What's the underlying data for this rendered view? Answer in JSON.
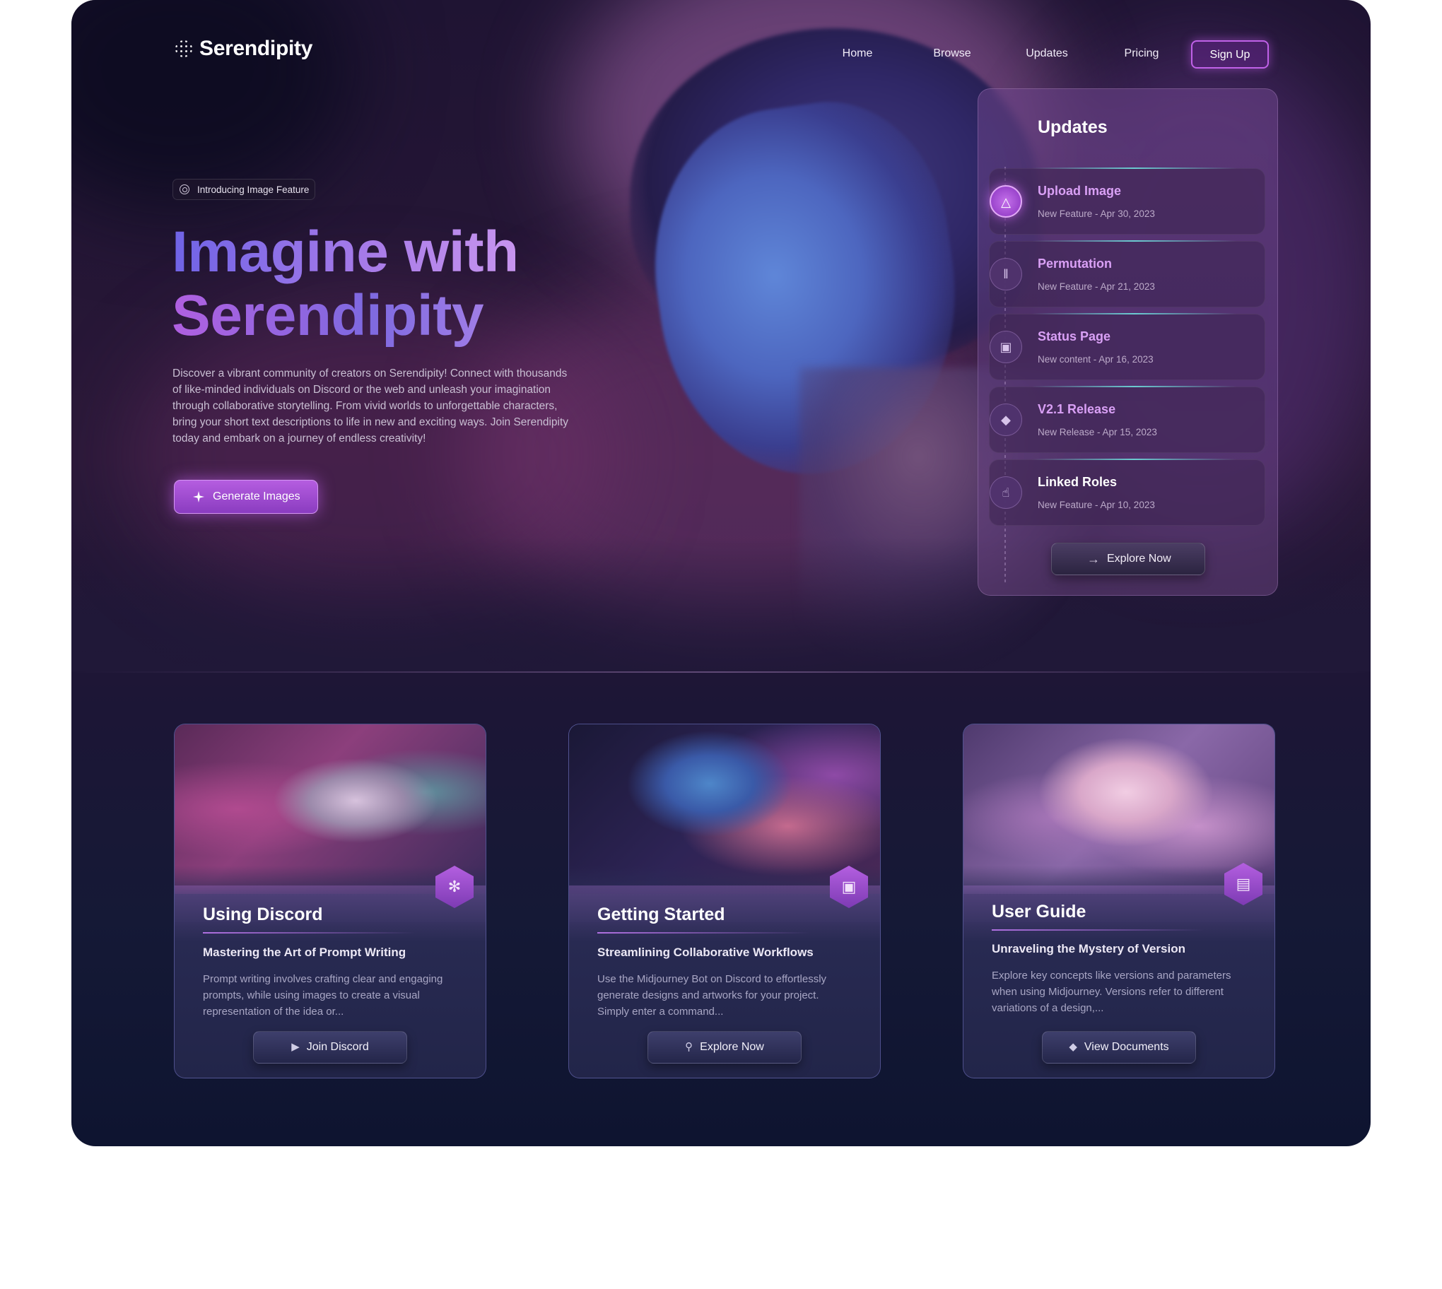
{
  "brand": {
    "name": "Serendipity"
  },
  "nav": {
    "items": [
      "Home",
      "Browse",
      "Updates",
      "Pricing"
    ],
    "signup_label": "Sign Up"
  },
  "hero": {
    "badge": "Introducing Image Feature",
    "headline_line1": "Imagine with",
    "headline_line2": "Serendipity",
    "description": "Discover a vibrant community of creators on Serendipity! Connect with thousands of like-minded individuals on Discord or the web and unleash your imagination through collaborative storytelling. From vivid worlds to unforgettable characters, bring your short text descriptions to life in new and exciting ways. Join Serendipity today and embark on a journey of endless creativity!",
    "cta_label": "Generate Images"
  },
  "updates": {
    "title": "Updates",
    "items": [
      {
        "title": "Upload Image",
        "subtitle": "New Feature - Apr 30, 2023",
        "icon": "upload-icon"
      },
      {
        "title": "Permutation",
        "subtitle": "New Feature - Apr 21, 2023",
        "icon": "waveform-icon"
      },
      {
        "title": "Status Page",
        "subtitle": "New content - Apr 16, 2023",
        "icon": "cube-icon"
      },
      {
        "title": "V2.1 Release",
        "subtitle": "New Release - Apr 15, 2023",
        "icon": "layers-icon"
      },
      {
        "title": "Linked Roles",
        "subtitle": "New Feature - Apr 10, 2023",
        "icon": "pointer-icon"
      }
    ],
    "explore_label": "Explore Now"
  },
  "cards": [
    {
      "title": "Using Discord",
      "subtitle": "Mastering the Art of Prompt Writing",
      "description": "Prompt writing involves crafting clear and engaging prompts, while using images to create a visual representation of the idea or...",
      "button_label": "Join Discord",
      "button_icon": "play-circle-icon",
      "badge_icon": "sparkle-shapes-icon"
    },
    {
      "title": "Getting Started",
      "subtitle": "Streamlining Collaborative Workflows",
      "description": "Use the Midjourney Bot on Discord to effortlessly generate designs and artworks for your project. Simply enter a command...",
      "button_label": "Explore Now",
      "button_icon": "search-icon",
      "badge_icon": "image-stack-icon"
    },
    {
      "title": "User Guide",
      "subtitle": "Unraveling the Mystery of Version",
      "description": "Explore key concepts like versions and parameters when using Midjourney. Versions refer to different variations of a design,...",
      "button_label": "View Documents",
      "button_icon": "layers-icon",
      "badge_icon": "document-icon"
    }
  ],
  "colors": {
    "accent": "#b55de0",
    "accent_light": "#d9a0f5",
    "background_top": "#1f1433",
    "background_bottom": "#0e1430"
  }
}
